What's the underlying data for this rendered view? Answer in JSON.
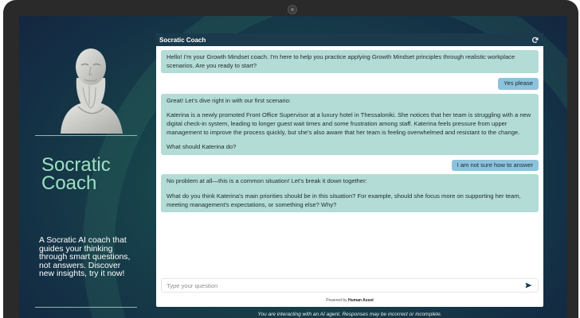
{
  "sidebar": {
    "brand_line1": "Socratic",
    "brand_line2": "Coach",
    "tagline": "A Socratic AI coach that guides your thinking through smart questions, not answers. Discover new insights, try it now!"
  },
  "chat": {
    "title": "Socratic Coach",
    "messages": [
      {
        "role": "bot",
        "paragraphs": [
          "Hello! I'm your Growth Mindset coach. I'm here to help you practice applying Growth Mindset principles through realistic workplace scenarios. Are you ready to start?"
        ]
      },
      {
        "role": "user",
        "text": "Yes please"
      },
      {
        "role": "bot",
        "paragraphs": [
          "Great! Let's dive right in with our first scenario:",
          "Katerina is a newly promoted Front Office Supervisor at a luxury hotel in Thessaloniki. She notices that her team is struggling with a new digital check-in system, leading to longer guest wait times and some frustration among staff. Katerina feels pressure from upper management to improve the process quickly, but she's also aware that her team is feeling overwhelmed and resistant to the change.",
          "What should Katerina do?"
        ]
      },
      {
        "role": "user",
        "text": "I am not sure how to answer"
      },
      {
        "role": "bot",
        "paragraphs": [
          "No problem at all—this is a common situation! Let's break it down together:",
          "What do you think Katerina's main priorities should be in this situation? For example, should she focus more on supporting her team, meeting management's expectations, or something else? Why?"
        ]
      }
    ],
    "input_placeholder": "Type your question",
    "powered_prefix": "Powered by",
    "powered_brand": "Human Asset",
    "disclaimer": "You are interacting with an AI agent. Responses may be incorrect or incomplete."
  },
  "icons": {
    "refresh": "refresh-icon",
    "send": "send-icon",
    "bust": "socrates-bust-image"
  },
  "colors": {
    "header": "#1b3a4c",
    "bot_bubble": "#b4dcd6",
    "user_bubble": "#8cc2dc",
    "brand_text": "#9fe0c2"
  }
}
